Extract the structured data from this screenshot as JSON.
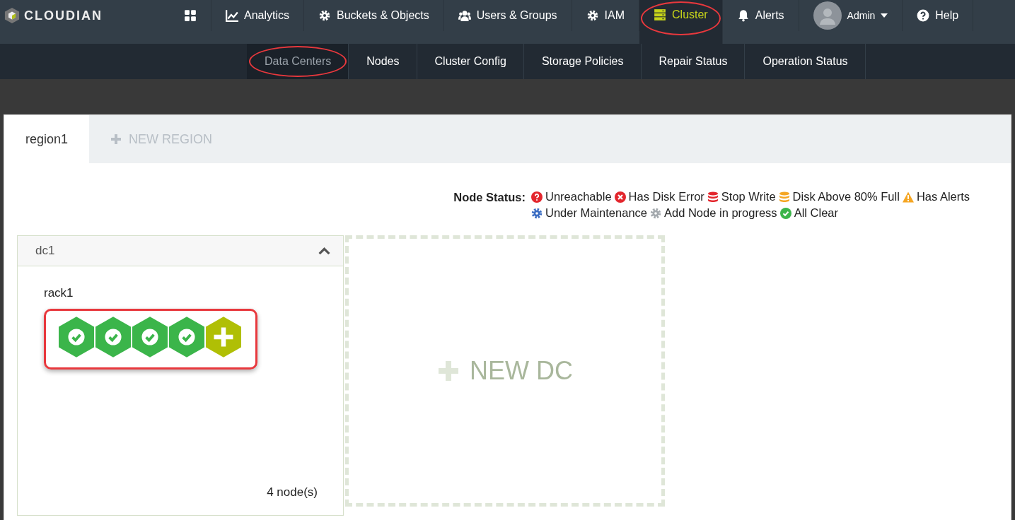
{
  "brand": {
    "name": "CLOUDIAN"
  },
  "nav": [
    {
      "kind": "dashboard",
      "selected": false,
      "annotated": false
    },
    {
      "kind": "chart",
      "label": "Analytics",
      "selected": false,
      "annotated": false
    },
    {
      "kind": "gear",
      "label": "Buckets & Objects",
      "selected": false,
      "annotated": false
    },
    {
      "kind": "users",
      "label": "Users & Groups",
      "selected": false,
      "annotated": false
    },
    {
      "kind": "gear",
      "label": "IAM",
      "selected": false,
      "annotated": false
    },
    {
      "kind": "server",
      "label": "Cluster",
      "selected": true,
      "annotated": true
    },
    {
      "kind": "bell",
      "label": "Alerts",
      "selected": false,
      "annotated": false
    },
    {
      "kind": "user",
      "label": "Admin",
      "selected": false,
      "annotated": false
    },
    {
      "kind": "help",
      "label": "Help",
      "selected": false,
      "annotated": false
    }
  ],
  "subnav": [
    {
      "label": "Data Centers",
      "selected": true,
      "annotated": true
    },
    {
      "label": "Nodes",
      "selected": false,
      "annotated": false
    },
    {
      "label": "Cluster Config",
      "selected": false,
      "annotated": false
    },
    {
      "label": "Storage Policies",
      "selected": false,
      "annotated": false
    },
    {
      "label": "Repair Status",
      "selected": false,
      "annotated": false
    },
    {
      "label": "Operation Status",
      "selected": false,
      "annotated": false
    }
  ],
  "region_tabs": [
    {
      "label": "region1",
      "kind": "tab",
      "selected": true
    },
    {
      "label": "NEW REGION",
      "kind": "add",
      "selected": false
    }
  ],
  "legend": {
    "title": "Node Status:",
    "items": [
      {
        "kind": "unreachable",
        "label": "Unreachable"
      },
      {
        "kind": "disk-error",
        "label": "Has Disk Error"
      },
      {
        "kind": "stop-write",
        "label": "Stop Write"
      },
      {
        "kind": "disk-full",
        "label": "Disk Above 80% Full"
      },
      {
        "kind": "alerts",
        "label": "Has Alerts"
      },
      {
        "kind": "maintenance",
        "label": "Under Maintenance"
      },
      {
        "kind": "adding",
        "label": "Add Node in progress"
      },
      {
        "kind": "clear",
        "label": "All Clear"
      }
    ]
  },
  "datacenters": [
    {
      "name": "dc1",
      "expanded": true,
      "racks": [
        {
          "name": "rack1",
          "annotated": true,
          "nodes": [
            {
              "kind": "clear"
            },
            {
              "kind": "clear"
            },
            {
              "kind": "clear"
            },
            {
              "kind": "clear"
            },
            {
              "kind": "add"
            }
          ]
        }
      ],
      "count": "4 node(s)"
    }
  ],
  "new_dc": {
    "label": "NEW DC"
  }
}
